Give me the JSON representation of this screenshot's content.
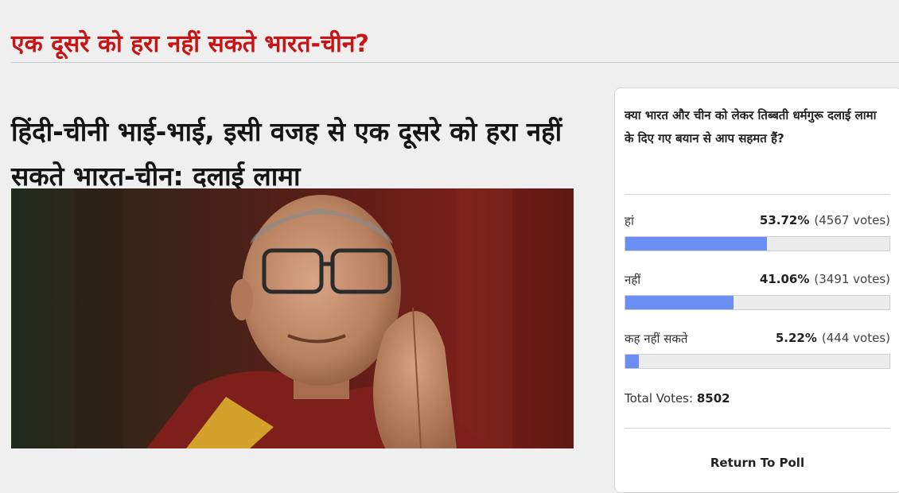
{
  "page": {
    "title": "एक दूसरे को हरा नहीं सकते भारत-चीन?"
  },
  "article": {
    "headline": "हिंदी-चीनी भाई-भाई, इसी वजह से एक दूसरे को हरा नहीं सकते भारत-चीन: दलाई लामा",
    "image_subject": "dalai-lama-portrait"
  },
  "poll": {
    "question": "क्या भारत और चीन को लेकर तिब्बती धर्मगुरू दलाई लामा के दिए गए बयान से आप सहमत हैं?",
    "options": [
      {
        "label": "हां",
        "percent": "53.72%",
        "votes": "(4567 votes)",
        "fill": 53.72
      },
      {
        "label": "नहीं",
        "percent": "41.06%",
        "votes": "(3491 votes)",
        "fill": 41.06
      },
      {
        "label": "कह नहीं सकते",
        "percent": "5.22%",
        "votes": "(444 votes)",
        "fill": 5.22
      }
    ],
    "total_label": "Total Votes:",
    "total_value": "8502",
    "return_label": "Return To Poll",
    "bar_color": "#6b8ef5"
  },
  "colors": {
    "title_red": "#c81414",
    "background": "#efefef"
  }
}
